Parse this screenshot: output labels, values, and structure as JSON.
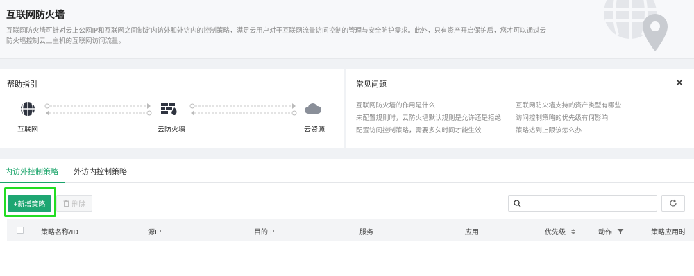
{
  "header": {
    "title": "互联网防火墙",
    "description": "互联网防火墙可针对云上公网IP和互联网之间制定内访外和外访内的控制策略，满足云用户对于互联网流量访问控制的管理与安全防护需求。此外，只有资产开启保护后，您才可以通过云防火墙控制云上主机的互联网访问流量。"
  },
  "help": {
    "title": "帮助指引",
    "nodes": {
      "internet": "互联网",
      "firewall": "云防火墙",
      "cloud": "云资源"
    }
  },
  "faq": {
    "title": "常见问题",
    "items": [
      "互联网防火墙的作用是什么",
      "未配置规则时，云防火墙默认规则是允许还是拒绝",
      "配置访问控制策略，需要多久时间才能生效",
      "互联网防火墙支持的资产类型有哪些",
      "访问控制策略的优先级有何影响",
      "策略达到上限该怎么办"
    ]
  },
  "tabs": [
    {
      "label": "内访外控制策略",
      "active": true
    },
    {
      "label": "外访内控制策略",
      "active": false
    }
  ],
  "toolbar": {
    "add_label": "+新增策略",
    "delete_label": "删除",
    "search_placeholder": "",
    "search_value": ""
  },
  "table": {
    "columns": [
      "策略名称/ID",
      "源IP",
      "目的IP",
      "服务",
      "应用",
      "优先级",
      "动作",
      "策略应用时"
    ]
  },
  "colors": {
    "accent": "#1aa46a",
    "highlight": "#22dd22"
  }
}
